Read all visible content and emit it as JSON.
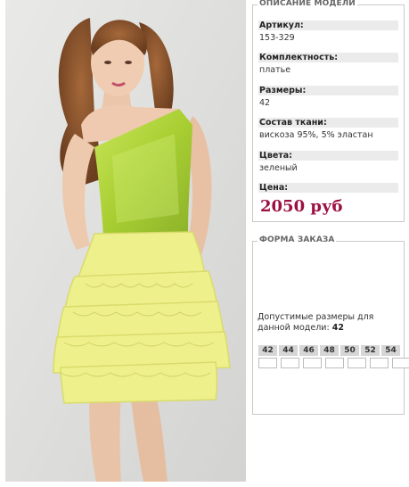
{
  "description_panel": {
    "legend": "ОПИСАНИЕ МОДЕЛИ",
    "fields": [
      {
        "label": "Артикул:",
        "value": "153-329"
      },
      {
        "label": "Комплектность:",
        "value": "платье"
      },
      {
        "label": "Размеры:",
        "value": "42"
      },
      {
        "label": "Состав ткани:",
        "value": "вискоза 95%, 5% эластан"
      },
      {
        "label": "Цвета:",
        "value": "зеленый"
      },
      {
        "label": "Цена:",
        "value": "2050 руб"
      }
    ]
  },
  "order_panel": {
    "legend": "ФОРМА ЗАКАЗА",
    "sizes_text": "Допустимые размеры для данной модели:",
    "sizes_value": "42",
    "size_columns": [
      "42",
      "44",
      "46",
      "48",
      "50",
      "52",
      "54"
    ]
  },
  "colors": {
    "price": "#9c1043",
    "dress_top": "#b3d43f",
    "dress_skirt": "#eef08c"
  }
}
